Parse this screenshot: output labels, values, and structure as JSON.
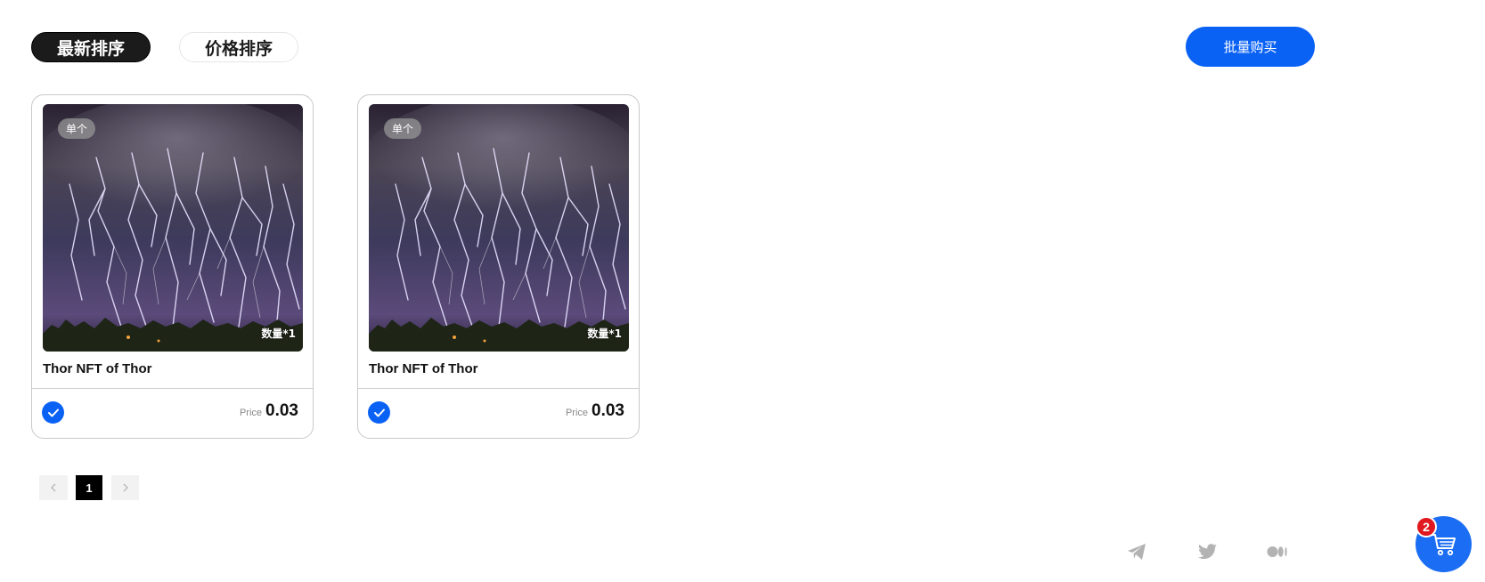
{
  "sort_tabs": {
    "newest_label": "最新排序",
    "price_label": "价格排序"
  },
  "bulk_buy_label": "批量购买",
  "cards": [
    {
      "badge": "单个",
      "quantity": "数量*1",
      "title": "Thor NFT of Thor",
      "price_label": "Price",
      "price": "0.03",
      "selected": true
    },
    {
      "badge": "单个",
      "quantity": "数量*1",
      "title": "Thor NFT of Thor",
      "price_label": "Price",
      "price": "0.03",
      "selected": true
    }
  ],
  "pagination": {
    "prev_icon": "chevron-left-icon",
    "current_page": "1",
    "next_icon": "chevron-right-icon"
  },
  "social_icons": [
    "telegram-icon",
    "twitter-icon",
    "medium-icon"
  ],
  "cart": {
    "count": "2",
    "icon": "shopping-cart-icon"
  },
  "colors": {
    "accent": "#0a62f5",
    "cart": "#1b6ef3",
    "cart_badge": "#e0181f",
    "active_tab": "#1b1b1b"
  }
}
